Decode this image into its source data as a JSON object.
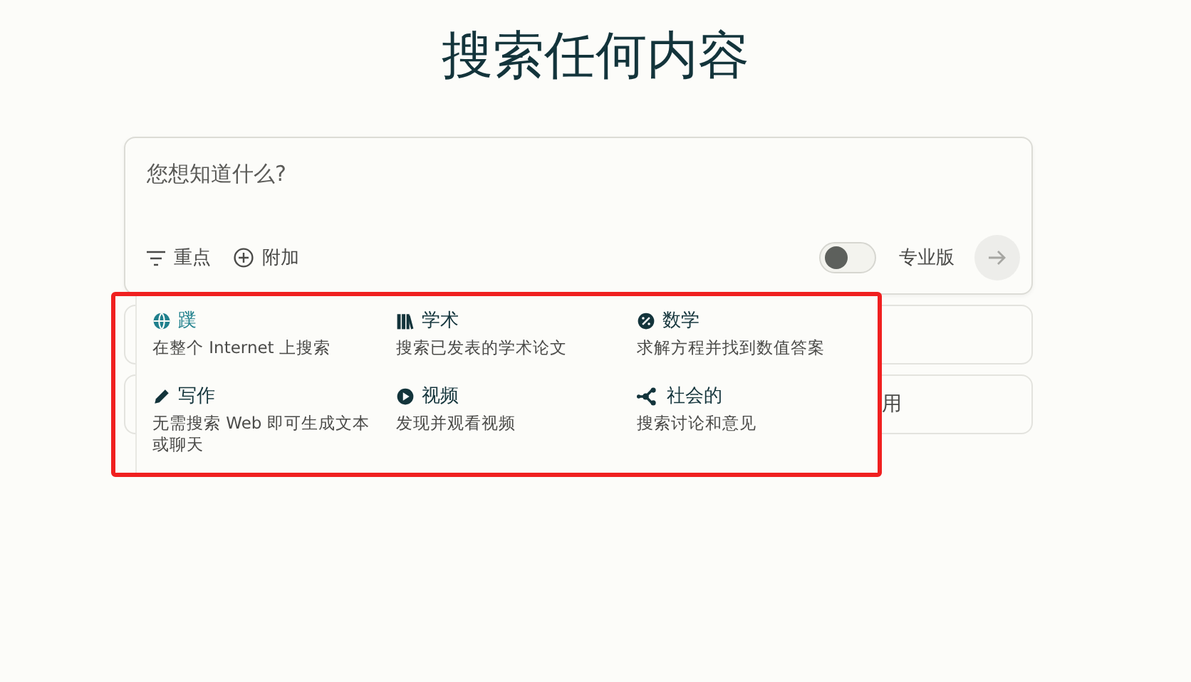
{
  "title": "搜索任何内容",
  "search": {
    "placeholder": "您想知道什么?",
    "focus_label": "重点",
    "attach_label": "附加",
    "pro": {
      "label": "专业版",
      "on": false
    }
  },
  "background_cards": [
    {
      "kind": "blank"
    },
    {
      "kind": "text",
      "text": "用"
    }
  ],
  "focus_menu": [
    {
      "kind": "globe",
      "label": "蹼",
      "description": "在整个 Internet 上搜索",
      "selected": true
    },
    {
      "kind": "books",
      "label": "学术",
      "description": "搜索已发表的学术论文",
      "selected": false
    },
    {
      "kind": "math",
      "label": "数学",
      "description": "求解方程并找到数值答案",
      "selected": false
    },
    {
      "kind": "pencil",
      "label": "写作",
      "description": "无需搜索 Web 即可生成文本或聊天",
      "selected": false
    },
    {
      "kind": "play",
      "label": "视频",
      "description": "发现并观看视频",
      "selected": false
    },
    {
      "kind": "network",
      "label": "社会的",
      "description": "搜索讨论和意见",
      "selected": false
    }
  ]
}
